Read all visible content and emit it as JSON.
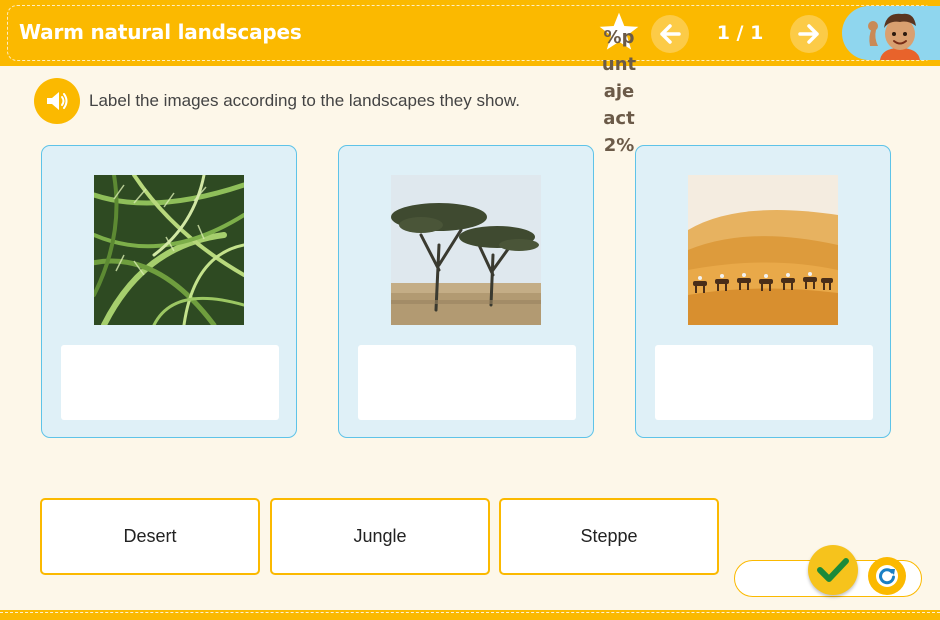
{
  "header": {
    "title": "Warm natural landscapes",
    "score_lines": [
      "%p",
      "unt",
      "aje",
      "act",
      "2%"
    ],
    "page_indicator": "1 / 1",
    "prev_icon": "arrow-left-icon",
    "next_icon": "arrow-right-icon",
    "star_icon": "star-icon",
    "avatar_icon": "boy-avatar-icon"
  },
  "instruction": {
    "icon": "speaker-icon",
    "text": "Label the images according to the landscapes they show."
  },
  "cards": [
    {
      "image": "jungle-palm-leaves-photo"
    },
    {
      "image": "savanna-acacia-trees-photo"
    },
    {
      "image": "desert-camel-caravan-photo"
    }
  ],
  "answer_chips": [
    "Desert",
    "Jungle",
    "Steppe"
  ],
  "controls": {
    "check_icon": "checkmark-icon",
    "reset_icon": "refresh-icon"
  },
  "colors": {
    "accent": "#fbb900",
    "card_bg": "#dff0f7",
    "card_border": "#5ec3e8",
    "page_bg": "#fdf7e9"
  }
}
